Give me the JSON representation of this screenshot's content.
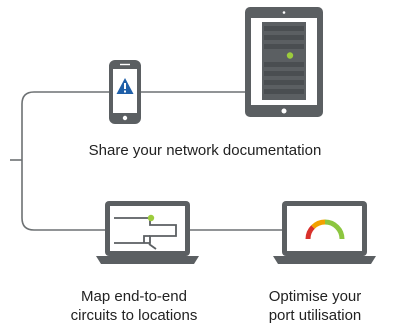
{
  "colors": {
    "device_frame": "#5b5f62",
    "line": "#6d7173",
    "screen": "#ffffff",
    "rack_bar": "#5b5f62",
    "status_dot": "#9ccc3c",
    "alert_blue": "#1f5fa8",
    "gauge_red": "#d9312b",
    "gauge_orange": "#f2a100",
    "gauge_green": "#8cc63f",
    "text": "#222222"
  },
  "icons": {
    "phone": "alert-triangle-icon",
    "tablet": "server-rack-icon",
    "laptop_left": "map-pin-icon",
    "laptop_right": "gauge-icon"
  },
  "captions": {
    "share": "Share your network documentation",
    "map_line1": "Map end-to-end",
    "map_line2": "circuits to locations",
    "port_line1": "Optimise your",
    "port_line2": "port utilisation"
  }
}
